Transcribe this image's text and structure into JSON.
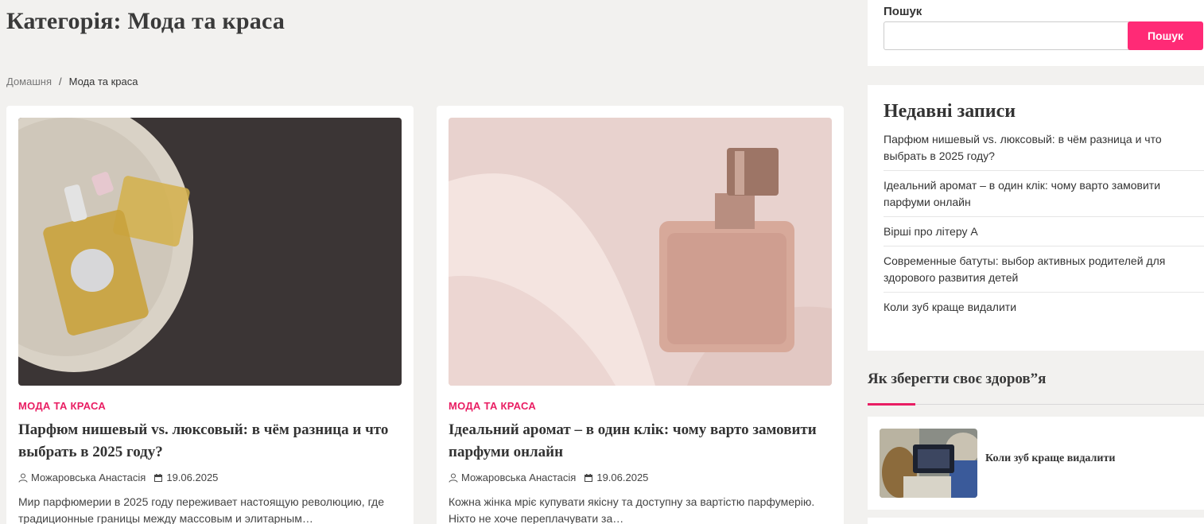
{
  "page": {
    "title": "Категорія: Мода та краса"
  },
  "breadcrumb": {
    "home": "Домашня",
    "separator": "/",
    "current": "Мода та краса"
  },
  "posts": [
    {
      "category": "МОДА ТА КРАСА",
      "title": "Парфюм нишевый vs. люксовый: в чём разница и что выбрать в 2025 году?",
      "author": "Можаровська Анастасія",
      "date": "19.06.2025",
      "excerpt": "Мир парфюмерии в 2025 году переживает настоящую революцию, где традиционные границы между массовым и элитарным…"
    },
    {
      "category": "МОДА ТА КРАСА",
      "title": "Ідеальний аромат – в один клік: чому варто замовити парфуми онлайн",
      "author": "Можаровська Анастасія",
      "date": "19.06.2025",
      "excerpt": "Кожна жінка мріє купувати якісну та доступну за вартістю парфумерію. Ніхто не хоче переплачувати за…"
    }
  ],
  "sidebar": {
    "search": {
      "label": "Пошук",
      "value": "",
      "button_label": "Пошук"
    },
    "recent": {
      "title": "Недавні записи",
      "items": [
        "Парфюм нишевый vs. люксовый: в чём разница и что выбрать в 2025 году?",
        "Ідеальний аромат – в один клік: чому варто замовити парфуми онлайн",
        "Вірші про літеру А",
        "Современные батуты: выбор активных родителей для здорового развития детей",
        "Коли зуб краще видалити"
      ]
    },
    "health": {
      "title": "Як зберегти своє здоров”я",
      "post_title": "Коли зуб краще видалити"
    }
  },
  "colors": {
    "accent": "#e91e63",
    "button": "#ff2a76",
    "background": "#f2f1ef"
  }
}
